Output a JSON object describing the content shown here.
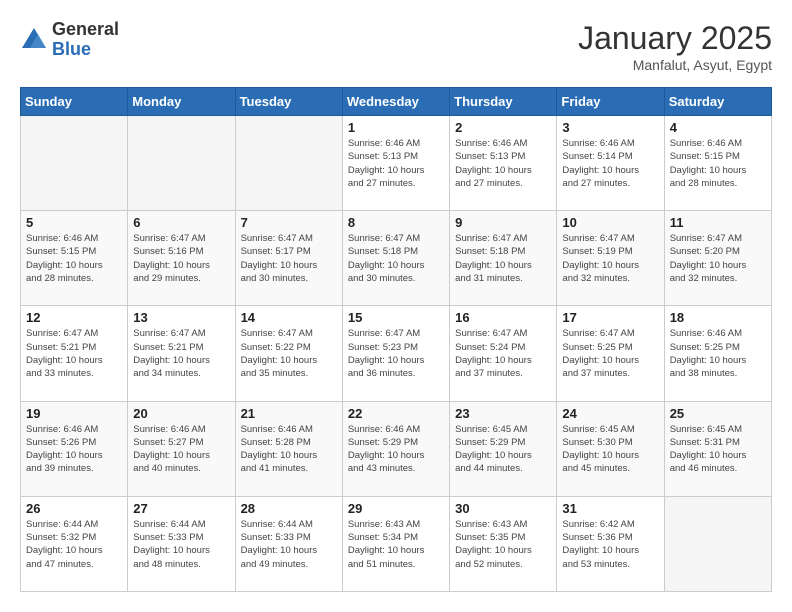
{
  "header": {
    "logo_general": "General",
    "logo_blue": "Blue",
    "month_title": "January 2025",
    "location": "Manfalut, Asyut, Egypt"
  },
  "weekdays": [
    "Sunday",
    "Monday",
    "Tuesday",
    "Wednesday",
    "Thursday",
    "Friday",
    "Saturday"
  ],
  "weeks": [
    [
      {
        "day": "",
        "info": ""
      },
      {
        "day": "",
        "info": ""
      },
      {
        "day": "",
        "info": ""
      },
      {
        "day": "1",
        "info": "Sunrise: 6:46 AM\nSunset: 5:13 PM\nDaylight: 10 hours\nand 27 minutes."
      },
      {
        "day": "2",
        "info": "Sunrise: 6:46 AM\nSunset: 5:13 PM\nDaylight: 10 hours\nand 27 minutes."
      },
      {
        "day": "3",
        "info": "Sunrise: 6:46 AM\nSunset: 5:14 PM\nDaylight: 10 hours\nand 27 minutes."
      },
      {
        "day": "4",
        "info": "Sunrise: 6:46 AM\nSunset: 5:15 PM\nDaylight: 10 hours\nand 28 minutes."
      }
    ],
    [
      {
        "day": "5",
        "info": "Sunrise: 6:46 AM\nSunset: 5:15 PM\nDaylight: 10 hours\nand 28 minutes."
      },
      {
        "day": "6",
        "info": "Sunrise: 6:47 AM\nSunset: 5:16 PM\nDaylight: 10 hours\nand 29 minutes."
      },
      {
        "day": "7",
        "info": "Sunrise: 6:47 AM\nSunset: 5:17 PM\nDaylight: 10 hours\nand 30 minutes."
      },
      {
        "day": "8",
        "info": "Sunrise: 6:47 AM\nSunset: 5:18 PM\nDaylight: 10 hours\nand 30 minutes."
      },
      {
        "day": "9",
        "info": "Sunrise: 6:47 AM\nSunset: 5:18 PM\nDaylight: 10 hours\nand 31 minutes."
      },
      {
        "day": "10",
        "info": "Sunrise: 6:47 AM\nSunset: 5:19 PM\nDaylight: 10 hours\nand 32 minutes."
      },
      {
        "day": "11",
        "info": "Sunrise: 6:47 AM\nSunset: 5:20 PM\nDaylight: 10 hours\nand 32 minutes."
      }
    ],
    [
      {
        "day": "12",
        "info": "Sunrise: 6:47 AM\nSunset: 5:21 PM\nDaylight: 10 hours\nand 33 minutes."
      },
      {
        "day": "13",
        "info": "Sunrise: 6:47 AM\nSunset: 5:21 PM\nDaylight: 10 hours\nand 34 minutes."
      },
      {
        "day": "14",
        "info": "Sunrise: 6:47 AM\nSunset: 5:22 PM\nDaylight: 10 hours\nand 35 minutes."
      },
      {
        "day": "15",
        "info": "Sunrise: 6:47 AM\nSunset: 5:23 PM\nDaylight: 10 hours\nand 36 minutes."
      },
      {
        "day": "16",
        "info": "Sunrise: 6:47 AM\nSunset: 5:24 PM\nDaylight: 10 hours\nand 37 minutes."
      },
      {
        "day": "17",
        "info": "Sunrise: 6:47 AM\nSunset: 5:25 PM\nDaylight: 10 hours\nand 37 minutes."
      },
      {
        "day": "18",
        "info": "Sunrise: 6:46 AM\nSunset: 5:25 PM\nDaylight: 10 hours\nand 38 minutes."
      }
    ],
    [
      {
        "day": "19",
        "info": "Sunrise: 6:46 AM\nSunset: 5:26 PM\nDaylight: 10 hours\nand 39 minutes."
      },
      {
        "day": "20",
        "info": "Sunrise: 6:46 AM\nSunset: 5:27 PM\nDaylight: 10 hours\nand 40 minutes."
      },
      {
        "day": "21",
        "info": "Sunrise: 6:46 AM\nSunset: 5:28 PM\nDaylight: 10 hours\nand 41 minutes."
      },
      {
        "day": "22",
        "info": "Sunrise: 6:46 AM\nSunset: 5:29 PM\nDaylight: 10 hours\nand 43 minutes."
      },
      {
        "day": "23",
        "info": "Sunrise: 6:45 AM\nSunset: 5:29 PM\nDaylight: 10 hours\nand 44 minutes."
      },
      {
        "day": "24",
        "info": "Sunrise: 6:45 AM\nSunset: 5:30 PM\nDaylight: 10 hours\nand 45 minutes."
      },
      {
        "day": "25",
        "info": "Sunrise: 6:45 AM\nSunset: 5:31 PM\nDaylight: 10 hours\nand 46 minutes."
      }
    ],
    [
      {
        "day": "26",
        "info": "Sunrise: 6:44 AM\nSunset: 5:32 PM\nDaylight: 10 hours\nand 47 minutes."
      },
      {
        "day": "27",
        "info": "Sunrise: 6:44 AM\nSunset: 5:33 PM\nDaylight: 10 hours\nand 48 minutes."
      },
      {
        "day": "28",
        "info": "Sunrise: 6:44 AM\nSunset: 5:33 PM\nDaylight: 10 hours\nand 49 minutes."
      },
      {
        "day": "29",
        "info": "Sunrise: 6:43 AM\nSunset: 5:34 PM\nDaylight: 10 hours\nand 51 minutes."
      },
      {
        "day": "30",
        "info": "Sunrise: 6:43 AM\nSunset: 5:35 PM\nDaylight: 10 hours\nand 52 minutes."
      },
      {
        "day": "31",
        "info": "Sunrise: 6:42 AM\nSunset: 5:36 PM\nDaylight: 10 hours\nand 53 minutes."
      },
      {
        "day": "",
        "info": ""
      }
    ]
  ]
}
